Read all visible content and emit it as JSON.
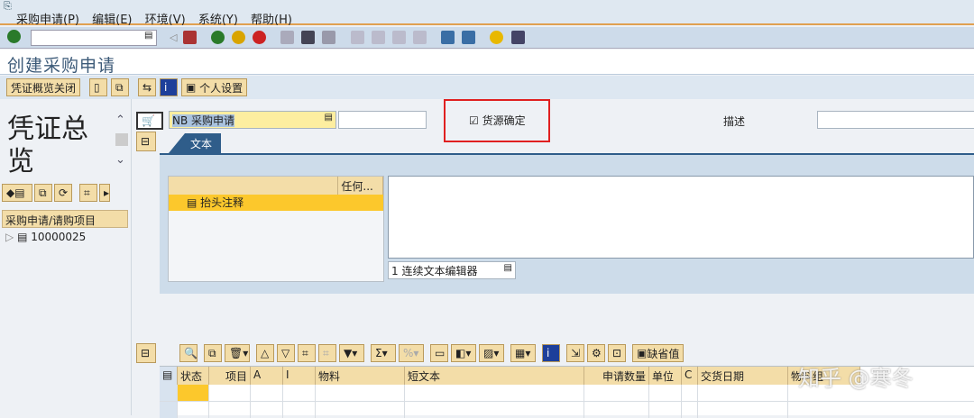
{
  "menu": [
    "采购申请(P)",
    "编辑(E)",
    "环境(V)",
    "系统(Y)",
    "帮助(H)"
  ],
  "title": "创建采购申请",
  "app_toolbar": {
    "close_overview": "凭证概览关闭",
    "personal_settings": "个人设置"
  },
  "left": {
    "title_line1": "凭证总",
    "title_line2": "览",
    "tree_header": "采购申请/请购项目",
    "tree_item": "10000025"
  },
  "header": {
    "doc_type": "NB 采购申请",
    "source_determination": "货源确定",
    "source_checked": true,
    "description_label": "描述"
  },
  "text_tab": {
    "tab_label": "文本",
    "col_any": "任何...",
    "row": "抬头注释",
    "editor_select": "1 连续文本编辑器"
  },
  "items": {
    "defaults_button": "缺省值",
    "columns": [
      "状态",
      "项目",
      "A",
      "I",
      "物料",
      "短文本",
      "申请数量",
      "单位",
      "C",
      "交货日期",
      "物料组"
    ]
  },
  "watermark": "知乎 @寒冬"
}
